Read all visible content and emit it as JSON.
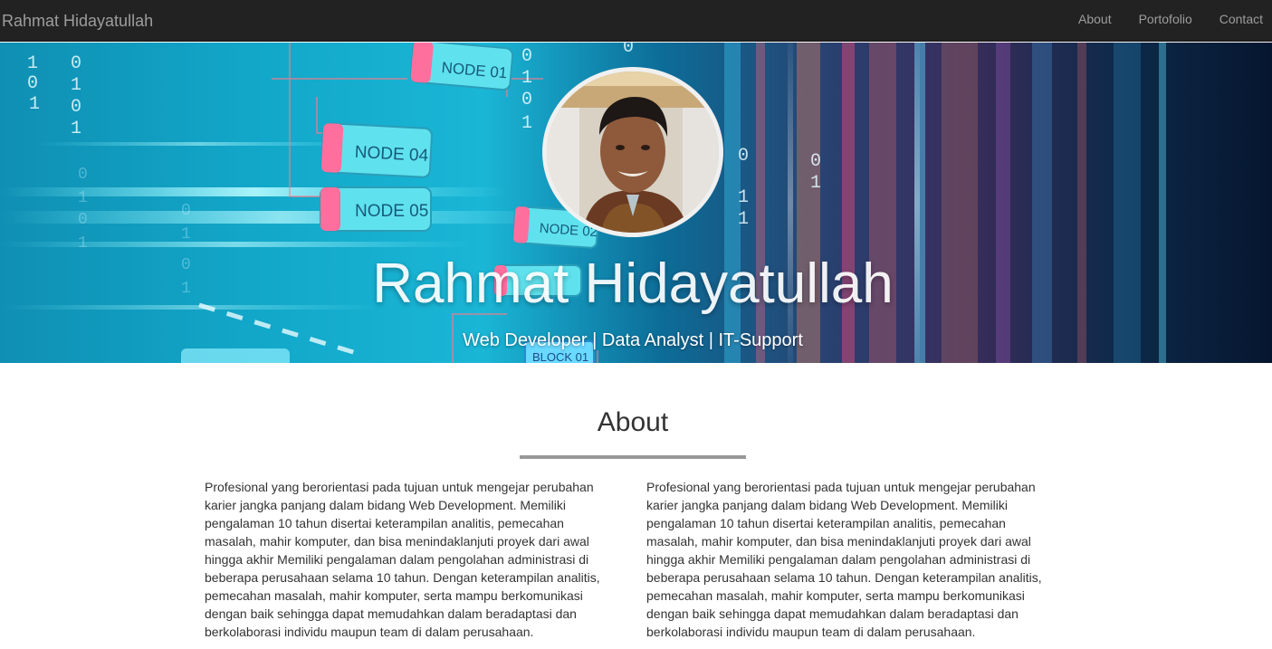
{
  "navbar": {
    "brand": "Rahmat Hidayatullah",
    "links": [
      "About",
      "Portofolio",
      "Contact"
    ]
  },
  "hero": {
    "title": "Rahmat Hidayatullah",
    "subtitle": "Web Developer | Data Analyst | IT-Support",
    "background_labels": [
      "NODE 01",
      "NODE 04",
      "NODE 05",
      "NODE 02",
      "BLOCK 01"
    ]
  },
  "about": {
    "heading": "About",
    "left_text": "Profesional yang berorientasi pada tujuan untuk mengejar perubahan karier jangka panjang dalam bidang Web Development. Memiliki pengalaman 10 tahun disertai keterampilan analitis, pemecahan masalah, mahir komputer, dan bisa menindaklanjuti proyek dari awal hingga akhir Memiliki pengalaman dalam pengolahan administrasi di beberapa perusahaan selama 10 tahun. Dengan keterampilan analitis, pemecahan masalah, mahir komputer, serta mampu berkomunikasi dengan baik sehingga dapat memudahkan dalam beradaptasi dan berkolaborasi individu maupun team di dalam perusahaan.",
    "right_text": "Profesional yang berorientasi pada tujuan untuk mengejar perubahan karier jangka panjang dalam bidang Web Development. Memiliki pengalaman 10 tahun disertai keterampilan analitis, pemecahan masalah, mahir komputer, dan bisa menindaklanjuti proyek dari awal hingga akhir Memiliki pengalaman dalam pengolahan administrasi di beberapa perusahaan selama 10 tahun. Dengan keterampilan analitis, pemecahan masalah, mahir komputer, serta mampu berkomunikasi dengan baik sehingga dapat memudahkan dalam beradaptasi dan berkolaborasi individu maupun team di dalam perusahaan."
  },
  "colors": {
    "navbar_bg": "#222222",
    "navbar_text": "#9d9d9d",
    "divider": "#999999",
    "body_text": "#333333"
  }
}
